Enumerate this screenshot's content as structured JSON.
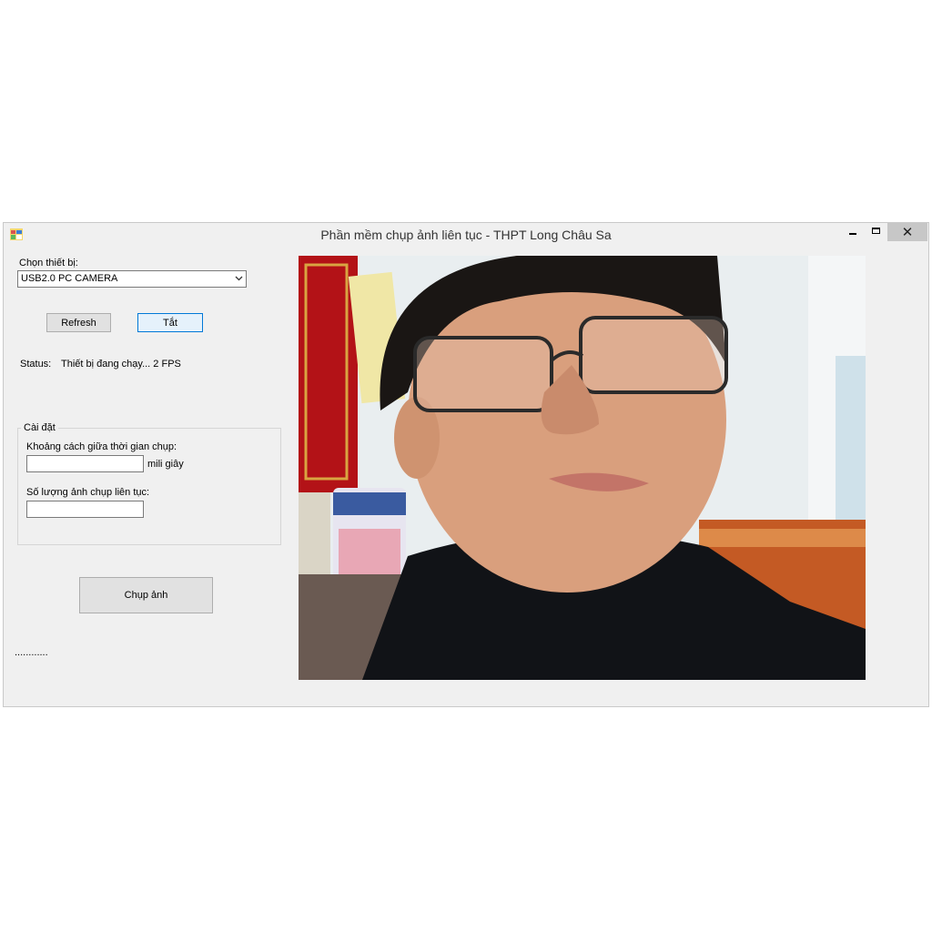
{
  "window": {
    "title": "Phần mềm chụp ảnh liên tục - THPT Long Châu Sa",
    "close_glyph": "✕"
  },
  "device": {
    "label": "Chọn thiết bị:",
    "selected": "USB2.0 PC CAMERA"
  },
  "buttons": {
    "refresh": "Refresh",
    "toggle": "Tắt",
    "capture": "Chụp ảnh"
  },
  "status": {
    "label": "Status:",
    "value": "Thiết bị đang chạy... 2 FPS"
  },
  "settings": {
    "legend": "Cài đặt",
    "interval_label": "Khoảng cách giữa thời gian chụp:",
    "interval_value": "",
    "interval_unit": "mili giây",
    "count_label": "Số lượng ảnh chụp liên tục:",
    "count_value": ""
  },
  "footer": {
    "progress_text": "............"
  },
  "icons": {
    "app": "app-window-icon",
    "dropdown": "chevron-down-icon",
    "minimize": "minimize-icon",
    "maximize": "maximize-icon",
    "close": "close-icon"
  },
  "colors": {
    "window_bg": "#f0f0f0",
    "focus_border": "#0078d7",
    "close_bg": "#c7c7c7"
  }
}
